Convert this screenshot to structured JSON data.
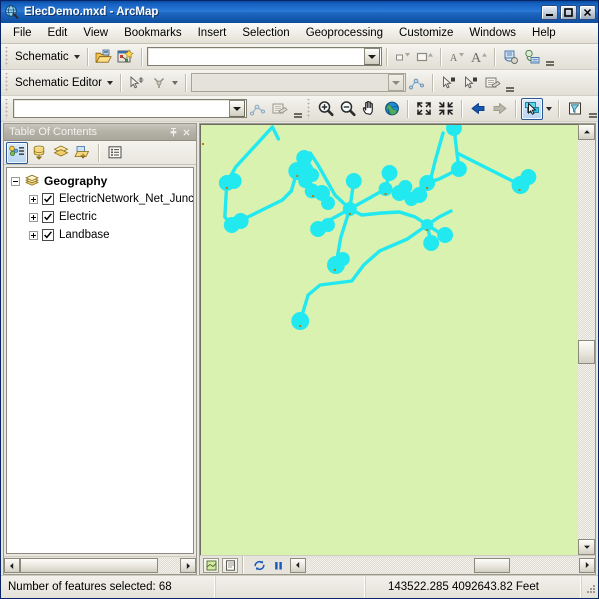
{
  "window": {
    "title": "ElecDemo.mxd - ArcMap",
    "icon": "arcmap-globe-icon",
    "buttons": {
      "minimize": "minimize-button",
      "maximize": "maximize-button",
      "close": "close-button"
    }
  },
  "menubar": {
    "items": [
      {
        "label": "File"
      },
      {
        "label": "Edit"
      },
      {
        "label": "View"
      },
      {
        "label": "Bookmarks"
      },
      {
        "label": "Insert"
      },
      {
        "label": "Selection"
      },
      {
        "label": "Geoprocessing"
      },
      {
        "label": "Customize"
      },
      {
        "label": "Windows"
      },
      {
        "label": "Help"
      }
    ]
  },
  "toolbars": {
    "schematic": {
      "menu_label": "Schematic",
      "combo_value": "",
      "buttons": [
        {
          "name": "open-schematic-folder-icon"
        },
        {
          "name": "new-schematic-diagram-icon"
        },
        {
          "name": "schematic-small-shape-icon"
        },
        {
          "name": "schematic-large-shape-icon"
        },
        {
          "name": "schematic-small-text-icon"
        },
        {
          "name": "schematic-large-text-icon"
        },
        {
          "name": "schematic-node-properties-icon"
        },
        {
          "name": "schematic-link-properties-icon"
        }
      ]
    },
    "schematic_editor": {
      "menu_label": "Schematic Editor",
      "combo_value": "",
      "buttons": [
        {
          "name": "schematic-move-pointer-icon"
        },
        {
          "name": "schematic-branch-tool-icon"
        },
        {
          "name": "schematic-link-edit-icon"
        },
        {
          "name": "schematic-select-node-icon"
        },
        {
          "name": "schematic-select-link-icon"
        },
        {
          "name": "schematic-attributes-icon"
        }
      ]
    },
    "network_analysis": {
      "combo_value": "",
      "buttons": [
        {
          "name": "trace-network-icon"
        },
        {
          "name": "network-attributes-icon"
        }
      ]
    },
    "tools": {
      "buttons": [
        {
          "name": "zoom-in-icon"
        },
        {
          "name": "zoom-out-icon"
        },
        {
          "name": "pan-hand-icon"
        },
        {
          "name": "full-extent-globe-icon"
        },
        {
          "name": "fixed-zoom-in-icon"
        },
        {
          "name": "fixed-zoom-out-icon"
        },
        {
          "name": "go-back-extent-icon"
        },
        {
          "name": "go-forward-extent-icon"
        },
        {
          "name": "select-features-icon"
        },
        {
          "name": "select-features-dropdown-icon"
        },
        {
          "name": "clear-selection-icon"
        }
      ]
    }
  },
  "toc": {
    "title": "Table Of Contents",
    "pin_icon": "pin-icon",
    "close_icon": "close-icon",
    "tool_buttons": [
      {
        "name": "list-by-drawing-order-icon",
        "active": true
      },
      {
        "name": "list-by-source-icon",
        "active": false
      },
      {
        "name": "list-by-visibility-icon",
        "active": false
      },
      {
        "name": "list-by-selection-icon",
        "active": false
      },
      {
        "name": "toc-options-icon",
        "active": false
      }
    ],
    "tree": {
      "group": {
        "label": "Geography",
        "expanded": true,
        "icon": "data-frame-icon"
      },
      "layers": [
        {
          "label": "ElectricNetwork_Net_Junc",
          "checked": true,
          "expanded": false
        },
        {
          "label": "Electric",
          "checked": true,
          "expanded": false
        },
        {
          "label": "Landbase",
          "checked": true,
          "expanded": false
        }
      ]
    }
  },
  "map": {
    "background_color": "#d9f2b0",
    "feature_color": "#22e8f0",
    "selection_color": "#22e8f0",
    "vertex_color": "#c07a10",
    "bottom_buttons": [
      {
        "name": "data-view-icon"
      },
      {
        "name": "layout-view-icon"
      },
      {
        "name": "refresh-view-icon"
      },
      {
        "name": "pause-drawing-icon"
      },
      {
        "name": "map-scroll-left-icon"
      },
      {
        "name": "map-scroll-right-icon"
      }
    ]
  },
  "statusbar": {
    "selection_text": "Number of features selected: 68",
    "middle_text": "",
    "coordinates": "143522.285  4092643.82 Feet"
  }
}
